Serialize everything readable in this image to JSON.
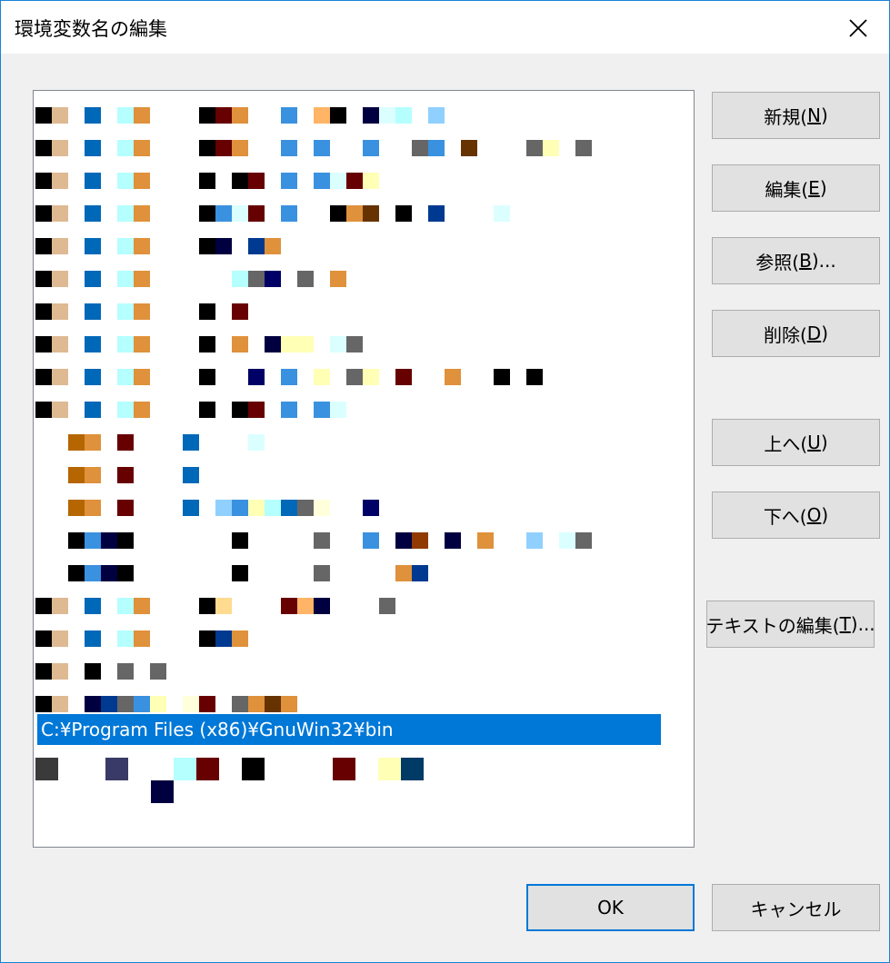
{
  "window": {
    "title": "環境変数名の編集"
  },
  "list": {
    "selected_item": "C:¥Program Files (x86)¥GnuWin32¥bin"
  },
  "buttons": {
    "new": {
      "label": "新規(",
      "mnemonic": "N",
      "suffix": ")"
    },
    "edit": {
      "label": "編集(",
      "mnemonic": "E",
      "suffix": ")"
    },
    "browse": {
      "label": "参照(",
      "mnemonic": "B",
      "suffix": ")..."
    },
    "delete": {
      "label": "削除(",
      "mnemonic": "D",
      "suffix": ")"
    },
    "move_up": {
      "label": "上へ(",
      "mnemonic": "U",
      "suffix": ")"
    },
    "move_down": {
      "label": "下へ(",
      "mnemonic": "O",
      "suffix": ")"
    },
    "edit_text": {
      "label": "テキストの編集(",
      "mnemonic": "T",
      "suffix": ")..."
    },
    "ok": {
      "label": "OK"
    },
    "cancel": {
      "label": "キャンセル"
    }
  },
  "colors": {
    "accent": "#0078d7",
    "selection_text": "#ffffff",
    "button_face": "#e1e1e1",
    "window_border": "#1883d7"
  }
}
